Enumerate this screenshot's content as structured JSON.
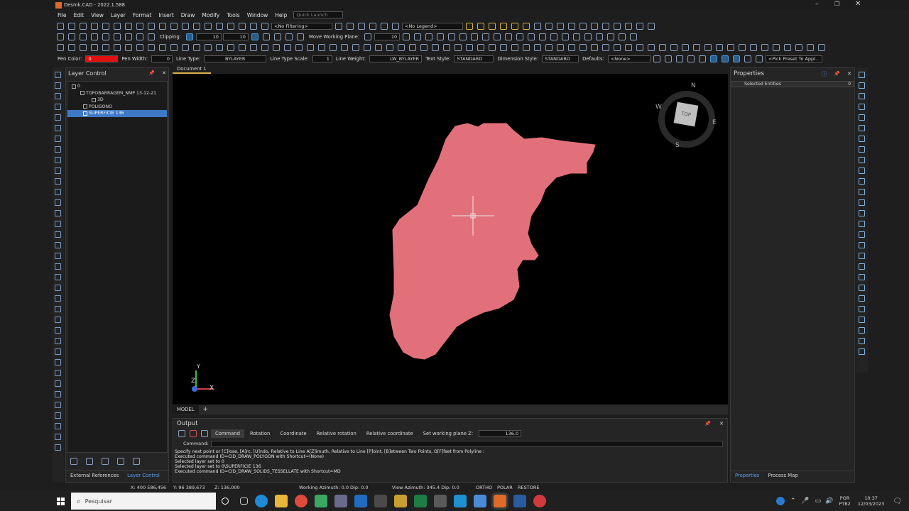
{
  "app": {
    "title": "Desmk.CAD - 2022.1.588"
  },
  "menu": [
    "File",
    "Edit",
    "View",
    "Layer",
    "Format",
    "Insert",
    "Draw",
    "Modify",
    "Tools",
    "Window",
    "Help"
  ],
  "quick_launch_placeholder": "Quick Launch",
  "toolbar": {
    "filter_value": "<No Filtering>",
    "legend_value": "<No Legend>",
    "clipping_label": "Clipping:",
    "clip_value_1": "10",
    "clip_value_2": "10",
    "move_working_plane_label": "Move Working Plane:",
    "move_plane_value": "10"
  },
  "props_bar": {
    "pen_color_label": "Pen Color:",
    "pen_color_value": "0",
    "pen_width_label": "Pen Width:",
    "pen_width_value": "0",
    "line_type_label": "Line Type:",
    "line_type_value": "BYLAYER",
    "line_type_scale_label": "Line Type Scale:",
    "line_type_scale_value": "1",
    "line_weight_label": "Line Weight:",
    "line_weight_value": "LW_BYLAYER",
    "text_style_label": "Text Style:",
    "text_style_value": "STANDARD",
    "dimension_style_label": "Dimension Style:",
    "dimension_style_value": "STANDARD",
    "defaults_label": "Defaults:",
    "defaults_value": "<None>",
    "pick_preset_value": "<Pick Preset To Appl..."
  },
  "layer_panel": {
    "title": "Layer Control",
    "items": [
      {
        "label": "0",
        "indent": 0
      },
      {
        "label": "TOPOBARRAGEM_NMP 13-12-21",
        "indent": 1
      },
      {
        "label": "3D",
        "indent": 2
      },
      {
        "label": "POLIGONO",
        "indent": 1
      },
      {
        "label": "SUPERFICIE 136",
        "indent": 1,
        "selected": true
      }
    ],
    "tabs": [
      "External References",
      "Layer Control"
    ]
  },
  "document_tab": "Document 1",
  "compass": {
    "n": "N",
    "s": "S",
    "e": "E",
    "w": "W",
    "cube": "TOP"
  },
  "axes": {
    "x": "X",
    "y": "Y",
    "z": "Z"
  },
  "model_tab": "MODEL",
  "output": {
    "title": "Output",
    "tabs": [
      "Command",
      "Rotation",
      "Coordinate",
      "Relative rotation",
      "Relative coordinate",
      "Set working plane Z:"
    ],
    "working_plane_z": "136.0",
    "command_label": "Command:",
    "log": [
      "Specify next point or [C]lose, [A]rc, [U]ndo, Relative to Line A[Z]imuth, Relative to Line [P]oint, [B]etween Two Points, O[F]fset from Polyline :",
      "Executed command ID=CID_DRAW_POLYGON with Shortcut=(None)",
      "Selected layer set to 0",
      "Selected layer set to 0\\SUPERFICIE 136",
      "Executed command ID=CID_DRAW_SOLIDS_TESSELLATE with Shortcut=MD"
    ]
  },
  "properties": {
    "title": "Properties",
    "selected_label": "Selected Entities",
    "selected_count": "0",
    "tabs": [
      "Properties",
      "Process Map"
    ]
  },
  "status": {
    "x": "X: 400 586,456",
    "y": "Y: 96 389,673",
    "z": "Z: 136,000",
    "working_azimuth": "Working Azimuth: 0.0 Dip: 0.0",
    "view_azimuth": "View Azimuth: 345.4 Dip: 0.0",
    "ortho": "ORTHO",
    "polar": "POLAR",
    "restore": "RESTORE"
  },
  "taskbar": {
    "search_placeholder": "Pesquisar",
    "lang": "POR",
    "lang2": "PTB2",
    "time": "10:37",
    "date": "12/03/2023"
  },
  "colors": {
    "accent": "#3e79c7",
    "polygon": "#e2707a",
    "canvas": "#000000"
  }
}
